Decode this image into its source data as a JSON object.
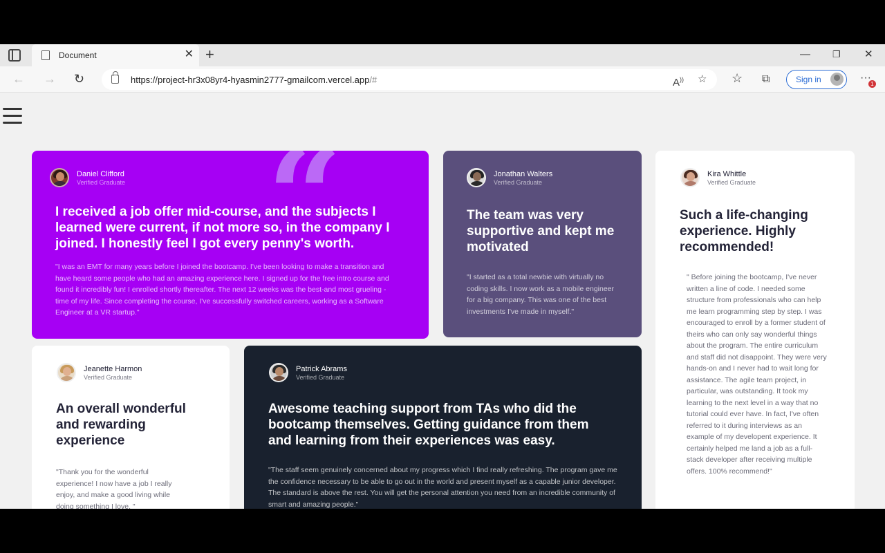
{
  "browser": {
    "tab_title": "Document",
    "url_host": "https://project-hr3x08yr4-hyasmin2777-gmailcom.vercel.app",
    "url_path": "/#",
    "sign_in_label": "Sign in",
    "notification_count": "1"
  },
  "testimonials": [
    {
      "name": "Daniel Clifford",
      "role": "Verified Graduate",
      "headline": "I received a job offer mid-course, and the subjects I learned were current, if not more so, in the company I joined. I honestly feel I got every penny's worth.",
      "body": "\"I was an EMT for many years before I joined the bootcamp. I've been looking to make a transition and have heard some people who had an amazing experience here. I signed up for the free intro course and found it incredibly fun! I enrolled shortly thereafter. The next 12 weeks was the best-and most grueling - time of my life. Since completing the course, I've successfully switched careers, working as a Software Engineer at a VR startup.\""
    },
    {
      "name": "Jonathan Walters",
      "role": "Verified Graduate",
      "headline": "The team was very supportive and kept me motivated",
      "body": "\"I started as a total newbie with virtually no coding skills. I now work as a mobile engineer for a big company. This was one of the best investments I've made in myself.\""
    },
    {
      "name": "Kira Whittle",
      "role": "Verified Graduate",
      "headline": "Such a life-changing experience. Highly recommended!",
      "body": "\" Before joining the bootcamp, I've never written a line of code. I needed some structure from professionals who can help me learn programming step by step. I was encouraged to enroll by a former student of theirs who can only say wonderful things about the program. The entire curriculum and staff did not disappoint. They were very hands-on and I never had to wait long for assistance. The agile team project, in particular, was outstanding. It took my learning to the next level in a way that no tutorial could ever have. In fact, I've often referred to it during interviews as an example of my developent experience. It certainly helped me land a job as a full-stack developer after receiving multiple offers. 100% recommend!\""
    },
    {
      "name": "Jeanette Harmon",
      "role": "Verified Graduate",
      "headline": "An overall wonderful and rewarding experience",
      "body": "\"Thank you for the wonderful experience! I now have a job I really enjoy, and make a good living while doing something I love. \""
    },
    {
      "name": "Patrick Abrams",
      "role": "Verified Graduate",
      "headline": "Awesome teaching support from TAs who did the bootcamp themselves. Getting guidance from them and learning from their experiences was easy.",
      "body": "\"The staff seem genuinely concerned about my progress which I find really refreshing. The program gave me the confidence necessary to be able to go out in the world and present myself as a capable junior developer. The standard is above the rest. You will get the personal attention you need from an incredible community of smart and amazing people.\""
    }
  ],
  "colors": {
    "purple_card": "#a600f4",
    "slate_card": "#5a4f7c",
    "dark_card": "#19212e",
    "white_card": "#ffffff",
    "page_bg": "#f1f1f1",
    "sign_in_accent": "#2b6cd4"
  },
  "icons": {
    "tab_actions": "tab-actions-icon",
    "tab_favicon": "page-icon",
    "back": "arrow-left-icon",
    "forward": "arrow-right-icon",
    "refresh": "refresh-icon",
    "lock": "lock-icon",
    "read_aloud": "read-aloud-icon",
    "add_favorite": "star-plus-icon",
    "favorites": "star-icon",
    "collections": "collections-icon",
    "more": "more-icon",
    "menu": "hamburger-icon",
    "quote": "quote-icon"
  }
}
